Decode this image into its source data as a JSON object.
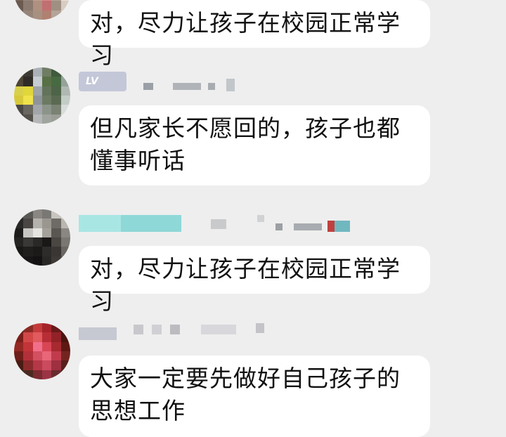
{
  "messages": [
    {
      "text": "对，尽力让孩子在校园正常学习"
    },
    {
      "badge": "LV",
      "text": "但凡家长不愿回的，孩子也都懂事听话"
    },
    {
      "text": "对，尽力让孩子在校园正常学习"
    },
    {
      "text": "大家一定要先做好自己孩子的思想工作"
    }
  ],
  "colors": {
    "background": "#eeeeee",
    "bubble": "#ffffff",
    "text": "#111111"
  }
}
